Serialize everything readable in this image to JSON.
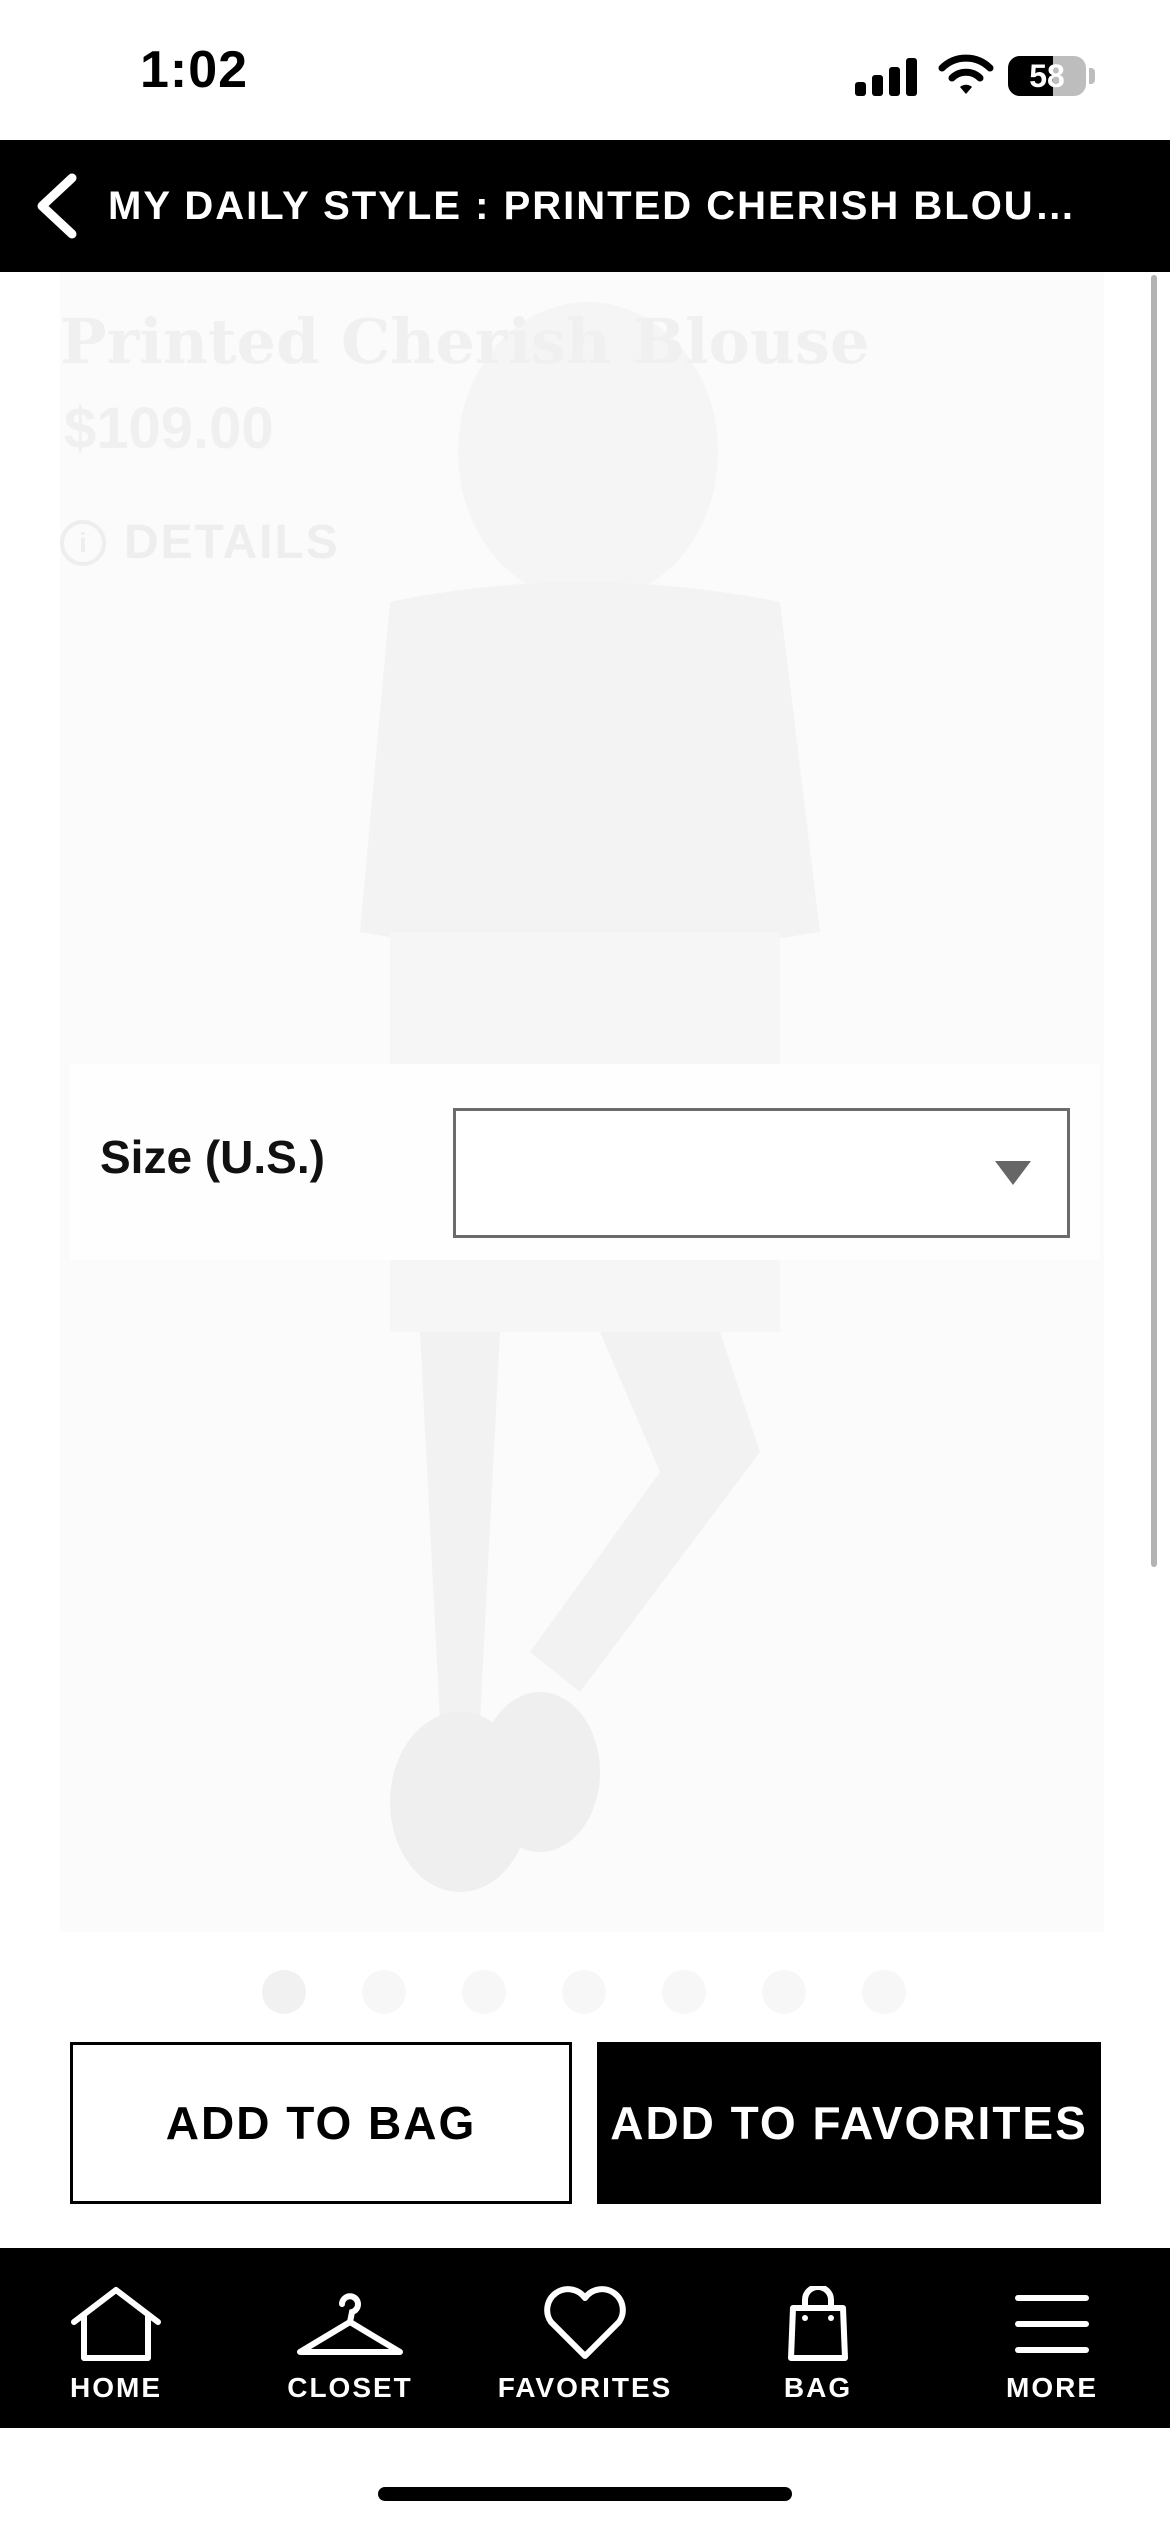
{
  "status_bar": {
    "time": "1:02",
    "battery_level": 58,
    "battery_label": "58"
  },
  "header": {
    "title": "MY DAILY STYLE : PRINTED CHERISH BLOU…"
  },
  "product": {
    "name": "Printed Cherish Blouse",
    "price": "$109.00",
    "details_label": "DETAILS"
  },
  "size_selector": {
    "label": "Size (U.S.)",
    "selected_value": ""
  },
  "carousel": {
    "count": 7,
    "active_index": 0
  },
  "actions": {
    "add_to_bag": "ADD TO BAG",
    "add_to_favorites": "ADD TO FAVORITES"
  },
  "tabbar": {
    "items": [
      {
        "label": "HOME",
        "icon": "home-icon"
      },
      {
        "label": "CLOSET",
        "icon": "hanger-icon"
      },
      {
        "label": "FAVORITES",
        "icon": "heart-icon"
      },
      {
        "label": "BAG",
        "icon": "shopping-bag-icon"
      },
      {
        "label": "MORE",
        "icon": "menu-icon"
      }
    ]
  },
  "colors": {
    "header_bg": "#000000",
    "accent": "#000000",
    "background": "#ffffff"
  }
}
